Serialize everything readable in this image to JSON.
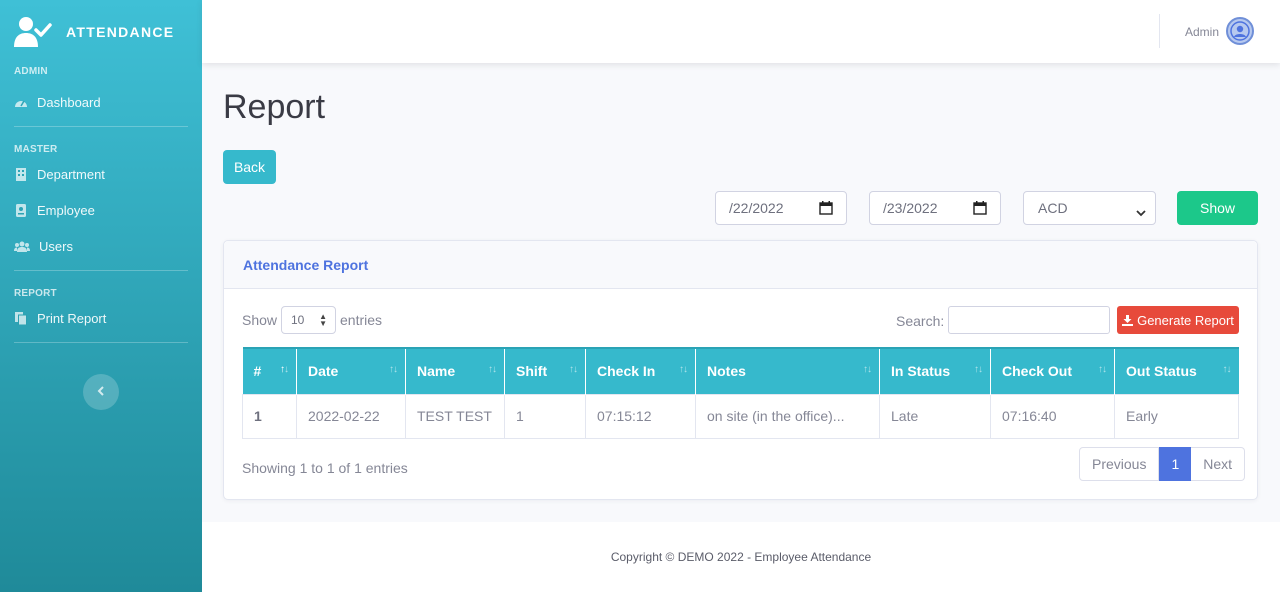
{
  "sidebar": {
    "brand": "ATTENDANCE",
    "sections": [
      {
        "heading": "ADMIN",
        "items": [
          {
            "label": "Dashboard",
            "icon": "tachometer-icon"
          }
        ]
      },
      {
        "heading": "MASTER",
        "items": [
          {
            "label": "Department",
            "icon": "building-icon"
          },
          {
            "label": "Employee",
            "icon": "id-badge-icon"
          },
          {
            "label": "Users",
            "icon": "users-icon"
          }
        ]
      },
      {
        "heading": "REPORT",
        "items": [
          {
            "label": "Print Report",
            "icon": "copy-icon"
          }
        ]
      }
    ]
  },
  "topbar": {
    "user_name": "Admin"
  },
  "page": {
    "title": "Report",
    "back_label": "Back"
  },
  "filters": {
    "date_from": "/22/2022",
    "date_to": "/23/2022",
    "department": "ACD",
    "show_label": "Show"
  },
  "card": {
    "title": "Attendance Report",
    "length": {
      "prefix": "Show",
      "value": "10",
      "suffix": "entries"
    },
    "search_label": "Search:",
    "search_value": "",
    "generate_label": "Generate Report",
    "columns": [
      "#",
      "Date",
      "Name",
      "Shift",
      "Check In",
      "Notes",
      "In Status",
      "Check Out",
      "Out Status"
    ],
    "rows": [
      [
        "1",
        "2022-02-22",
        "TEST TEST",
        "1",
        "07:15:12",
        "on site (in the office)...",
        "Late",
        "07:16:40",
        "Early"
      ]
    ],
    "info": "Showing 1 to 1 of 1 entries",
    "pagination": {
      "previous": "Previous",
      "current": "1",
      "next": "Next"
    }
  },
  "footer": {
    "text": "Copyright © DEMO 2022 - Employee Attendance"
  },
  "colors": {
    "primary": "#4e73df",
    "info": "#36b9cc",
    "success": "#1cc88a",
    "danger": "#e74a3b"
  }
}
